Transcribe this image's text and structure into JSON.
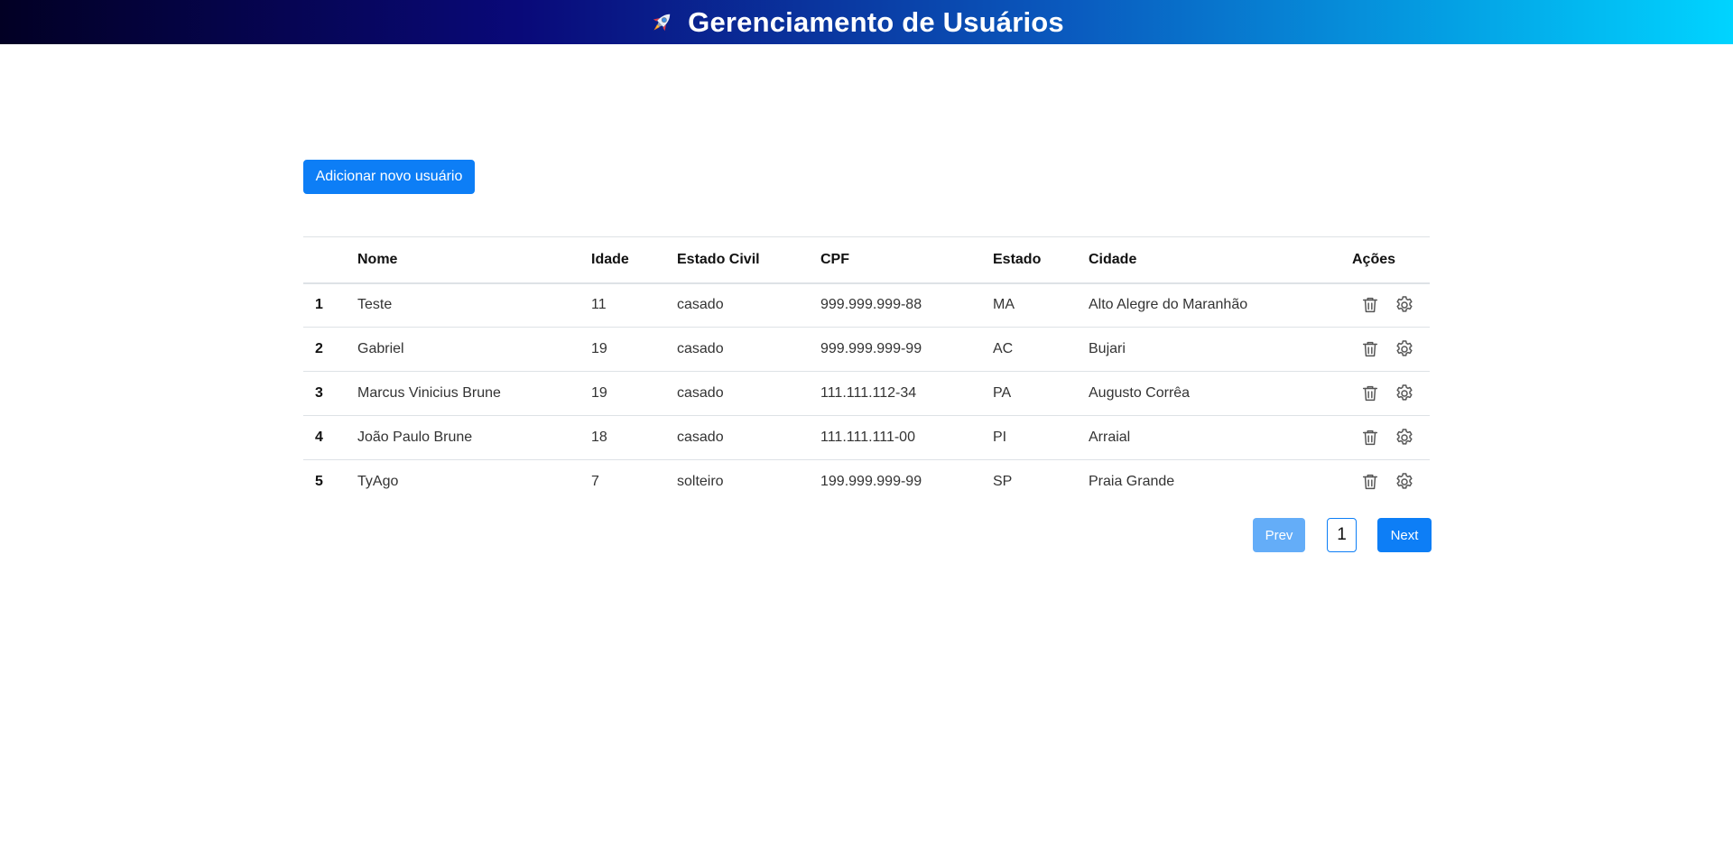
{
  "header": {
    "title": "Gerenciamento de Usuários",
    "icon": "rocket-icon",
    "gradient": [
      "#020024",
      "#090979",
      "#00d4ff"
    ]
  },
  "toolbar": {
    "add_label": "Adicionar novo usuário"
  },
  "table": {
    "columns": [
      "",
      "Nome",
      "Idade",
      "Estado Civil",
      "CPF",
      "Estado",
      "Cidade",
      "Ações"
    ],
    "rows": [
      {
        "idx": "1",
        "nome": "Teste",
        "idade": "11",
        "estado_civil": "casado",
        "cpf": "999.999.999-88",
        "estado": "MA",
        "cidade": "Alto Alegre do Maranhão"
      },
      {
        "idx": "2",
        "nome": "Gabriel",
        "idade": "19",
        "estado_civil": "casado",
        "cpf": "999.999.999-99",
        "estado": "AC",
        "cidade": "Bujari"
      },
      {
        "idx": "3",
        "nome": "Marcus Vinicius Brune",
        "idade": "19",
        "estado_civil": "casado",
        "cpf": "111.111.112-34",
        "estado": "PA",
        "cidade": "Augusto Corrêa"
      },
      {
        "idx": "4",
        "nome": "João Paulo Brune",
        "idade": "18",
        "estado_civil": "casado",
        "cpf": "111.111.111-00",
        "estado": "PI",
        "cidade": "Arraial"
      },
      {
        "idx": "5",
        "nome": "TyAgo",
        "idade": "7",
        "estado_civil": "solteiro",
        "cpf": "199.999.999-99",
        "estado": "SP",
        "cidade": "Praia Grande"
      }
    ],
    "row_actions": [
      "trash-icon",
      "gear-icon"
    ]
  },
  "pagination": {
    "prev_label": "Prev",
    "current_page": "1",
    "next_label": "Next"
  },
  "colors": {
    "primary": "#0d7ef6",
    "primary_disabled": "#64adf8"
  }
}
